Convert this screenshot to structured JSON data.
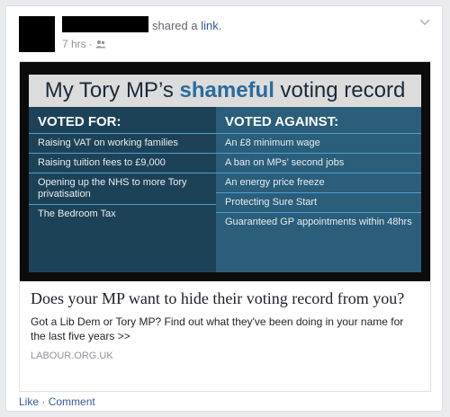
{
  "post": {
    "action_prefix": "shared a ",
    "action_link": "link",
    "action_suffix": ".",
    "time": "7 hrs",
    "separator": "·",
    "audience_icon": "friends-icon"
  },
  "graphic": {
    "title_part1": "My Tory MP’s ",
    "title_emph": "shameful",
    "title_part2": " voting record",
    "voted_for_heading": "VOTED FOR:",
    "voted_for": [
      "Raising VAT on working families",
      "Raising tuition fees to £9,000",
      "Opening up the NHS to more Tory privatisation",
      "The Bedroom Tax"
    ],
    "voted_against_heading": "VOTED AGAINST:",
    "voted_against": [
      "An £8 minimum wage",
      "A ban on MPs’ second jobs",
      "An energy price freeze",
      "Protecting Sure Start",
      "Guaranteed GP appointments within 48hrs"
    ]
  },
  "link_card": {
    "title": "Does your MP want to hide their voting record from you?",
    "description": "Got a Lib Dem or Tory MP? Find out what they've been doing in your name for the last five years >>",
    "domain": "LABOUR.ORG.UK"
  },
  "actions": {
    "like": "Like",
    "sep": " · ",
    "comment": "Comment"
  }
}
